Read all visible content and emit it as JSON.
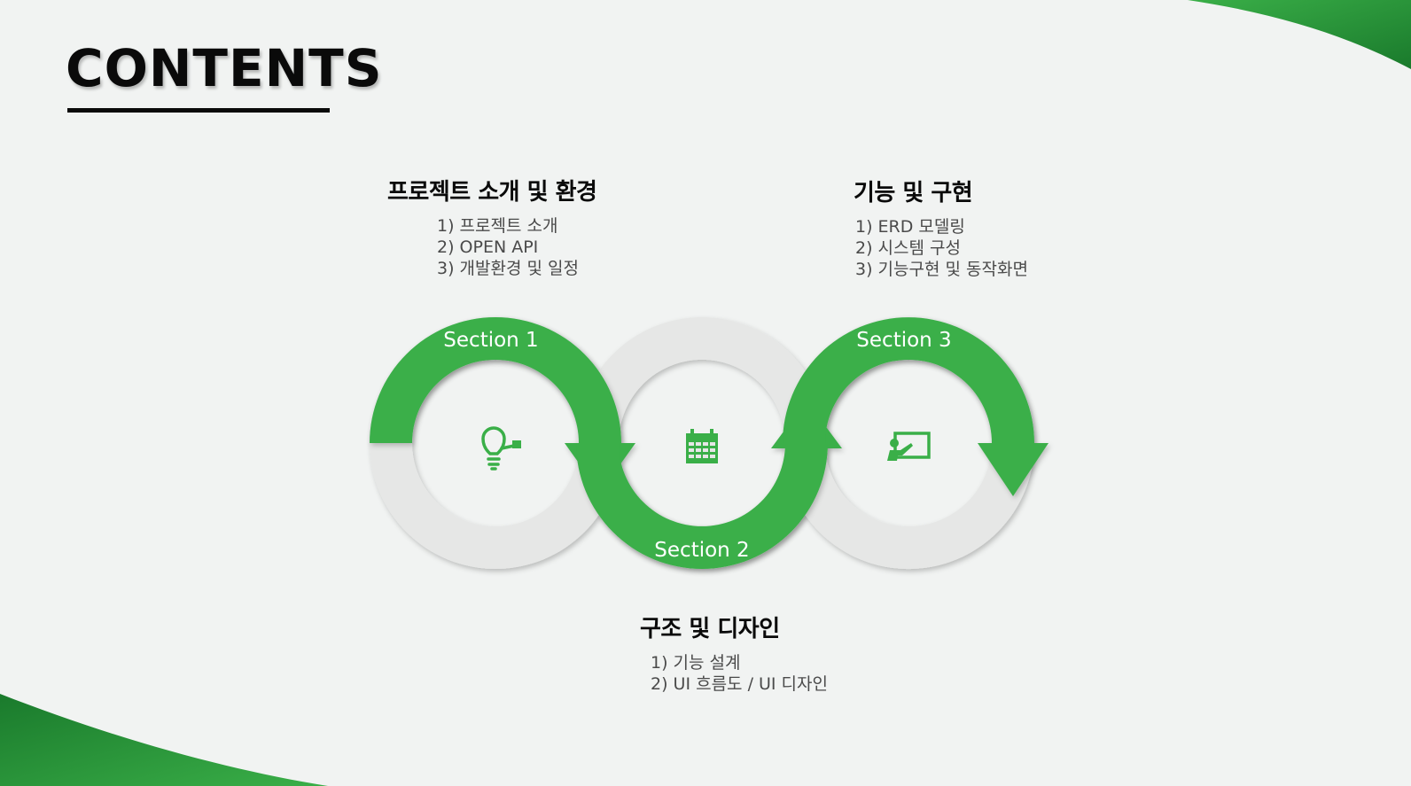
{
  "title": "CONTENTS",
  "colors": {
    "accent": "#3aaf48",
    "accent_dark": "#1a7a2c",
    "ring": "#e6e7e6",
    "background": "#f1f3f2"
  },
  "sections": [
    {
      "label": "Section 1",
      "heading": "프로젝트 소개 및 환경",
      "items": [
        "1) 프로젝트 소개",
        "2) OPEN API",
        "3) 개발환경 및 일정"
      ],
      "icon": "lightbulb-icon"
    },
    {
      "label": "Section 2",
      "heading": "구조 및 디자인",
      "items": [
        "1) 기능 설계",
        "2) UI 흐름도 / UI 디자인"
      ],
      "icon": "calendar-icon"
    },
    {
      "label": "Section 3",
      "heading": "기능 및 구현",
      "items": [
        "1) ERD 모델링",
        "2) 시스템 구성",
        "3) 기능구현 및 동작화면"
      ],
      "icon": "presenter-icon"
    }
  ]
}
